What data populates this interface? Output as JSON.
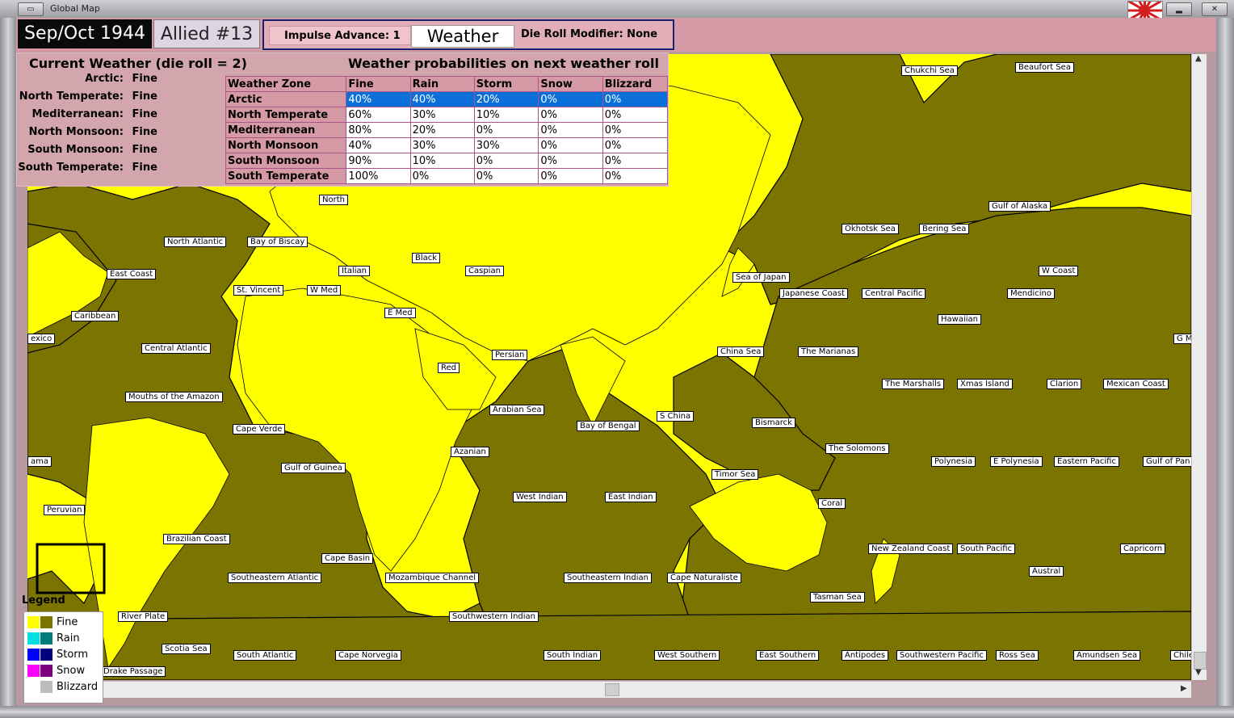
{
  "window": {
    "title": "Global Map"
  },
  "header": {
    "date": "Sep/Oct 1944",
    "turn": "Allied #13",
    "impulse": "Impulse Advance: 1",
    "mode": "Weather",
    "die_roll_modifier": "Die Roll Modifier: None"
  },
  "weather": {
    "current_title": "Current Weather (die roll = 2)",
    "current": [
      {
        "zone": "Arctic:",
        "value": "Fine"
      },
      {
        "zone": "North Temperate:",
        "value": "Fine"
      },
      {
        "zone": "Mediterranean:",
        "value": "Fine"
      },
      {
        "zone": "North Monsoon:",
        "value": "Fine"
      },
      {
        "zone": "South Monsoon:",
        "value": "Fine"
      },
      {
        "zone": "South Temperate:",
        "value": "Fine"
      }
    ],
    "probabilities_title": "Weather probabilities on next weather roll",
    "headers": [
      "Weather Zone",
      "Fine",
      "Rain",
      "Storm",
      "Snow",
      "Blizzard"
    ],
    "rows": [
      {
        "zone": "Arctic",
        "values": [
          "40%",
          "40%",
          "20%",
          "0%",
          "0%"
        ],
        "selected": true
      },
      {
        "zone": "North Temperate",
        "values": [
          "60%",
          "30%",
          "10%",
          "0%",
          "0%"
        ]
      },
      {
        "zone": "Mediterranean",
        "values": [
          "80%",
          "20%",
          "0%",
          "0%",
          "0%"
        ]
      },
      {
        "zone": "North Monsoon",
        "values": [
          "40%",
          "30%",
          "30%",
          "0%",
          "0%"
        ]
      },
      {
        "zone": "South Monsoon",
        "values": [
          "90%",
          "10%",
          "0%",
          "0%",
          "0%"
        ]
      },
      {
        "zone": "South Temperate",
        "values": [
          "100%",
          "0%",
          "0%",
          "0%",
          "0%"
        ]
      }
    ]
  },
  "legend": {
    "title": "Legend",
    "items": [
      {
        "label": "Fine",
        "colors": [
          "#ffff00",
          "#7b7400"
        ]
      },
      {
        "label": "Rain",
        "colors": [
          "#00e0e0",
          "#007c7c"
        ]
      },
      {
        "label": "Storm",
        "colors": [
          "#0000ff",
          "#00007c"
        ]
      },
      {
        "label": "Snow",
        "colors": [
          "#ff00ff",
          "#7c007c"
        ]
      },
      {
        "label": "Blizzard",
        "colors": [
          "#ffffff",
          "#bdbdbd"
        ]
      }
    ]
  },
  "map": {
    "land_color": "#ffff00",
    "sea_color": "#7b7400",
    "sea_areas": [
      "Chukchi Sea",
      "Beaufort Sea",
      "North",
      "North Atlantic",
      "Bay of Biscay",
      "Black",
      "Caspian",
      "East Coast",
      "Italian",
      "St. Vincent",
      "W Med",
      "E Med",
      "Sea of Japan",
      "Japanese Coast",
      "Central Pacific",
      "W Coast",
      "Mendicino",
      "Okhotsk Sea",
      "Bering Sea",
      "Gulf of Alaska",
      "Hawaiian",
      "Caribbean",
      "exico",
      "Central Atlantic",
      "Persian",
      "China Sea",
      "The Marianas",
      "G M",
      "Red",
      "The Marshalls",
      "Xmas Island",
      "Clarion",
      "Mexican Coast",
      "Mouths of the Amazon",
      "Arabian Sea",
      "Bay of Bengal",
      "S China",
      "Bismarck",
      "Cape Verde",
      "The Solomons",
      "Azanian",
      "ama",
      "Gulf of Guinea",
      "Polynesia",
      "E Polynesia",
      "Eastern Pacific",
      "Gulf of Pan",
      "Timor Sea",
      "West Indian",
      "East Indian",
      "Peruvian",
      "Coral",
      "Brazilian Coast",
      "New Zealand Coast",
      "South Pacific",
      "Capricorn",
      "Cape Basin",
      "Austral",
      "Southeastern Atlantic",
      "Mozambique Channel",
      "Southeastern Indian",
      "Cape Naturaliste",
      "Tasman Sea",
      "River Plate",
      "Southwestern Indian",
      "Scotia Sea",
      "South Atlantic",
      "Cape Norvegia",
      "South Indian",
      "West Southern",
      "East Southern",
      "Antipodes",
      "Southwestern Pacific",
      "Ross Sea",
      "Amundsen Sea",
      "Chile",
      "Drake Passage"
    ]
  }
}
